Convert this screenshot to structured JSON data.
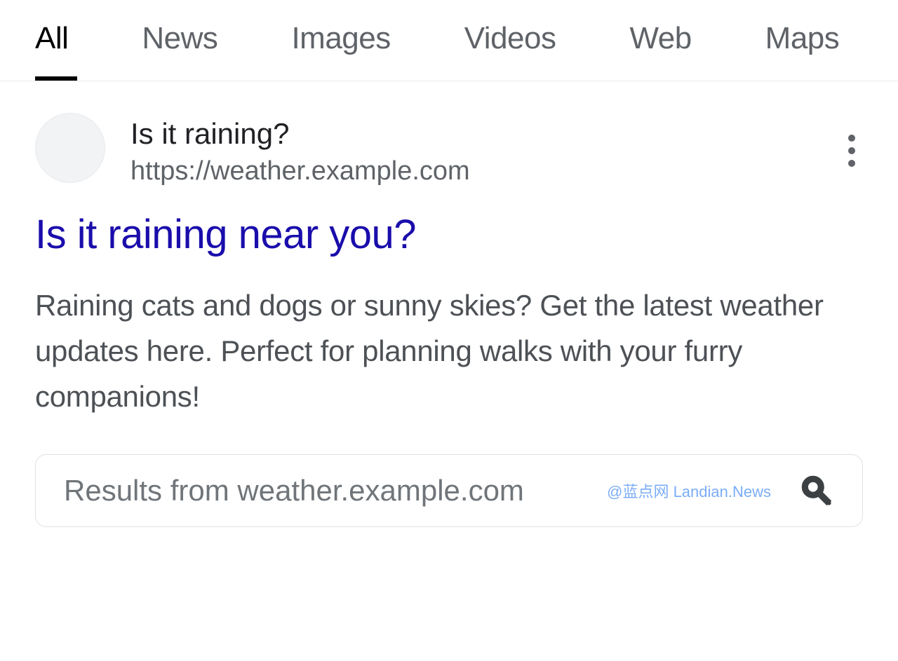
{
  "tabs": [
    {
      "label": "All",
      "active": true
    },
    {
      "label": "News",
      "active": false
    },
    {
      "label": "Images",
      "active": false
    },
    {
      "label": "Videos",
      "active": false
    },
    {
      "label": "Web",
      "active": false
    },
    {
      "label": "Maps",
      "active": false
    }
  ],
  "result": {
    "site_name": "Is it raining?",
    "site_url": "https://weather.example.com",
    "title": "Is it raining near you?",
    "snippet": "Raining cats and dogs or sunny skies? Get the latest weather updates here. Perfect for planning walks with your furry companions!"
  },
  "sitelinks_search": {
    "placeholder": "Results from weather.example.com"
  },
  "watermark": "@蓝点网 Landian.News"
}
